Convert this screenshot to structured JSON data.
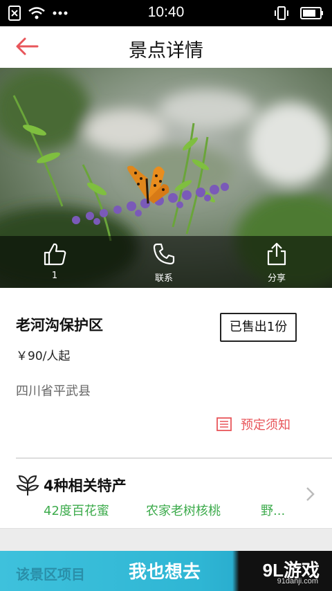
{
  "status_bar": {
    "time": "10:40"
  },
  "header": {
    "title": "景点详情"
  },
  "hero": {
    "actions": [
      {
        "icon": "thumbs-up-icon",
        "label": "1"
      },
      {
        "icon": "phone-icon",
        "label": "联系"
      },
      {
        "icon": "share-icon",
        "label": "分享"
      }
    ]
  },
  "spot": {
    "name": "老河沟保护区",
    "sold": "已售出1份",
    "price": "￥90/人起",
    "location": "四川省平武县",
    "notice_label": "预定须知"
  },
  "products": {
    "title": "4种相关特产",
    "items": [
      "42度百花蜜",
      "农家老树核桃",
      "野..."
    ]
  },
  "bottom_bar": {
    "project_tab": "该景区项目",
    "want_button": "我也想去",
    "watermark": "9L游戏",
    "watermark_sub": "91danji.com"
  },
  "colors": {
    "accent": "#e8555a",
    "green": "#3dab4c",
    "cyan": "#3ec1dc"
  }
}
